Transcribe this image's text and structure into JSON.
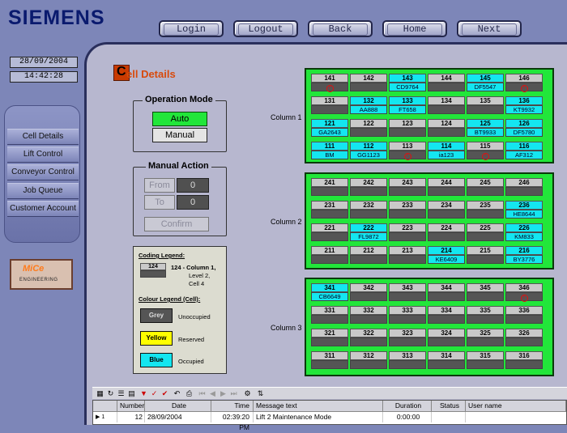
{
  "brand": "SIEMENS",
  "nav": [
    "Login",
    "Logout",
    "Back",
    "Home",
    "Next"
  ],
  "clock": {
    "date": "28/09/2004",
    "time": "14:42:28"
  },
  "sidebar": [
    "Cell Details",
    "Lift Control",
    "Conveyor Control",
    "Job Queue",
    "Customer Account"
  ],
  "logo": {
    "name": "MiCe",
    "sub": "ENGINEERING"
  },
  "page_title": {
    "initial": "C",
    "rest": "ell Details"
  },
  "operation_mode": {
    "title": "Operation Mode",
    "auto": "Auto",
    "manual": "Manual",
    "active": "Auto"
  },
  "manual_action": {
    "title": "Manual Action",
    "from_label": "From",
    "from_value": "0",
    "to_label": "To",
    "to_value": "0",
    "confirm": "Confirm"
  },
  "legend": {
    "coding_title": "Coding Legend:",
    "sample": "124",
    "sample_desc_1": "124 - Column 1,",
    "sample_desc_2": "Level 2,",
    "sample_desc_3": "Cell 4",
    "colour_title": "Colour Legend (Cell):",
    "grey": "Grey",
    "grey_desc": "Unoccupied",
    "yellow": "Yellow",
    "yellow_desc": "Reserved",
    "blue": "Blue",
    "blue_desc": "Occupied",
    "colors": {
      "grey": "#555555",
      "yellow": "#ffff00",
      "blue": "#14e6f0"
    }
  },
  "columns": [
    {
      "label": "Column 1",
      "rows": [
        [
          {
            "n": "141",
            "s": "err"
          },
          {
            "n": "142",
            "s": ""
          },
          {
            "n": "143",
            "s": "CD9764"
          },
          {
            "n": "144",
            "s": ""
          },
          {
            "n": "145",
            "s": "DF5547"
          },
          {
            "n": "146",
            "s": "err"
          }
        ],
        [
          {
            "n": "131",
            "s": ""
          },
          {
            "n": "132",
            "s": "AA888"
          },
          {
            "n": "133",
            "s": "FT658"
          },
          {
            "n": "134",
            "s": ""
          },
          {
            "n": "135",
            "s": ""
          },
          {
            "n": "136",
            "s": "KT9932"
          }
        ],
        [
          {
            "n": "121",
            "s": "GA2643"
          },
          {
            "n": "122",
            "s": ""
          },
          {
            "n": "123",
            "s": ""
          },
          {
            "n": "124",
            "s": ""
          },
          {
            "n": "125",
            "s": "BT9933"
          },
          {
            "n": "126",
            "s": "DF5780"
          }
        ],
        [
          {
            "n": "111",
            "s": "BM"
          },
          {
            "n": "112",
            "s": "GG1123"
          },
          {
            "n": "113",
            "s": "err"
          },
          {
            "n": "114",
            "s": "ia123"
          },
          {
            "n": "115",
            "s": "err"
          },
          {
            "n": "116",
            "s": "AF312"
          }
        ]
      ]
    },
    {
      "label": "Column 2",
      "rows": [
        [
          {
            "n": "241",
            "s": ""
          },
          {
            "n": "242",
            "s": ""
          },
          {
            "n": "243",
            "s": ""
          },
          {
            "n": "244",
            "s": ""
          },
          {
            "n": "245",
            "s": ""
          },
          {
            "n": "246",
            "s": ""
          }
        ],
        [
          {
            "n": "231",
            "s": ""
          },
          {
            "n": "232",
            "s": ""
          },
          {
            "n": "233",
            "s": ""
          },
          {
            "n": "234",
            "s": ""
          },
          {
            "n": "235",
            "s": ""
          },
          {
            "n": "236",
            "s": "HE8644"
          }
        ],
        [
          {
            "n": "221",
            "s": ""
          },
          {
            "n": "222",
            "s": "FL9872"
          },
          {
            "n": "223",
            "s": ""
          },
          {
            "n": "224",
            "s": ""
          },
          {
            "n": "225",
            "s": ""
          },
          {
            "n": "226",
            "s": "KM833"
          }
        ],
        [
          {
            "n": "211",
            "s": ""
          },
          {
            "n": "212",
            "s": ""
          },
          {
            "n": "213",
            "s": ""
          },
          {
            "n": "214",
            "s": "KE6409"
          },
          {
            "n": "215",
            "s": ""
          },
          {
            "n": "216",
            "s": "BY3776"
          }
        ]
      ]
    },
    {
      "label": "Column 3",
      "rows": [
        [
          {
            "n": "341",
            "s": "CB6649"
          },
          {
            "n": "342",
            "s": ""
          },
          {
            "n": "343",
            "s": ""
          },
          {
            "n": "344",
            "s": ""
          },
          {
            "n": "345",
            "s": ""
          },
          {
            "n": "346",
            "s": "err"
          }
        ],
        [
          {
            "n": "331",
            "s": ""
          },
          {
            "n": "332",
            "s": ""
          },
          {
            "n": "333",
            "s": ""
          },
          {
            "n": "334",
            "s": ""
          },
          {
            "n": "335",
            "s": ""
          },
          {
            "n": "336",
            "s": ""
          }
        ],
        [
          {
            "n": "321",
            "s": ""
          },
          {
            "n": "322",
            "s": ""
          },
          {
            "n": "323",
            "s": ""
          },
          {
            "n": "324",
            "s": ""
          },
          {
            "n": "325",
            "s": ""
          },
          {
            "n": "326",
            "s": ""
          }
        ],
        [
          {
            "n": "311",
            "s": ""
          },
          {
            "n": "312",
            "s": ""
          },
          {
            "n": "313",
            "s": ""
          },
          {
            "n": "314",
            "s": ""
          },
          {
            "n": "315",
            "s": ""
          },
          {
            "n": "316",
            "s": ""
          }
        ]
      ]
    }
  ],
  "log": {
    "headers": [
      "Number",
      "Date",
      "Time",
      "Message text",
      "Duration",
      "Status",
      "User name"
    ],
    "row": {
      "marker": "▶ 1",
      "number": "12",
      "date": "28/09/2004",
      "time": "02:39:20 PM",
      "message": "Lift 2 Maintenance Mode",
      "duration": "0:00:00",
      "status": "",
      "user": ""
    }
  }
}
